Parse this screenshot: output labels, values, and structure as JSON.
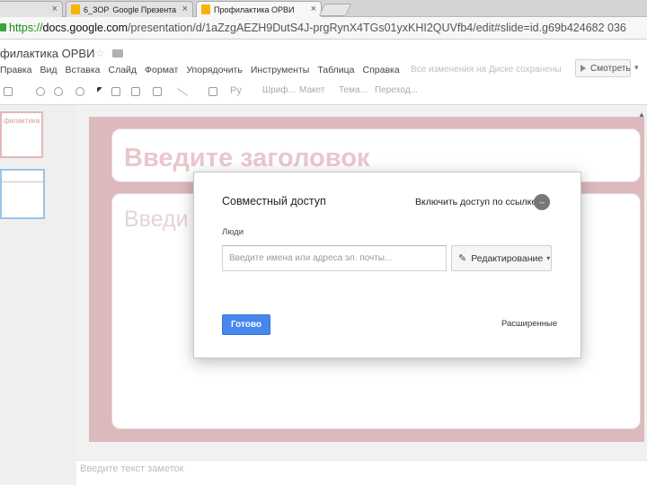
{
  "browser": {
    "tabs": [
      {
        "label": "6_ЗОР"
      },
      {
        "label": "Google Презента"
      },
      {
        "label": "Профилактика ОРВИ"
      }
    ],
    "tab_close_label": "×",
    "url_scheme": "https://",
    "url_host": "docs.google.com",
    "url_path": "/presentation/d/1aZzgAEZH9DutS4J-prgRynX4TGs01yxKHI2QUVfb4/edit#slide=id.g69b424682 036"
  },
  "docs": {
    "title": "филактика ОРВИ",
    "star_icon": "☆",
    "menu": [
      "Правка",
      "Вид",
      "Вставка",
      "Слайд",
      "Формат",
      "Упорядочить",
      "Инструменты",
      "Таблица",
      "Справка"
    ],
    "save_status": "Все изменения на Диске сохранены",
    "present_label": "Смотреть",
    "present_chevron": "▾",
    "toolbar": {
      "font_placeholder": "Шриф...",
      "layout_label": "Макет",
      "theme_label": "Тема...",
      "transition_label": "Переход..."
    }
  },
  "filmstrip": {
    "thumb1_text": "филактика"
  },
  "slide": {
    "title_placeholder": "Введите заголовок",
    "body_placeholder": "Введи",
    "notes_placeholder": "Введите текст заметок"
  },
  "share_dialog": {
    "title": "Совместный доступ",
    "link_sharing_label": "Включить доступ по ссылке",
    "link_icon": "⇔",
    "people_label": "Люди",
    "invite_placeholder": "Введите имена или адреса эл. почты...",
    "permission_label": "Редактирование",
    "permission_icon": "✎",
    "permission_caret": "▾",
    "done_label": "Готово",
    "advanced_label": "Расширенные"
  },
  "colors": {
    "slide_background": "#dcb9bd",
    "done_button": "#4787ed",
    "secure_url": "#1a8f1a"
  }
}
